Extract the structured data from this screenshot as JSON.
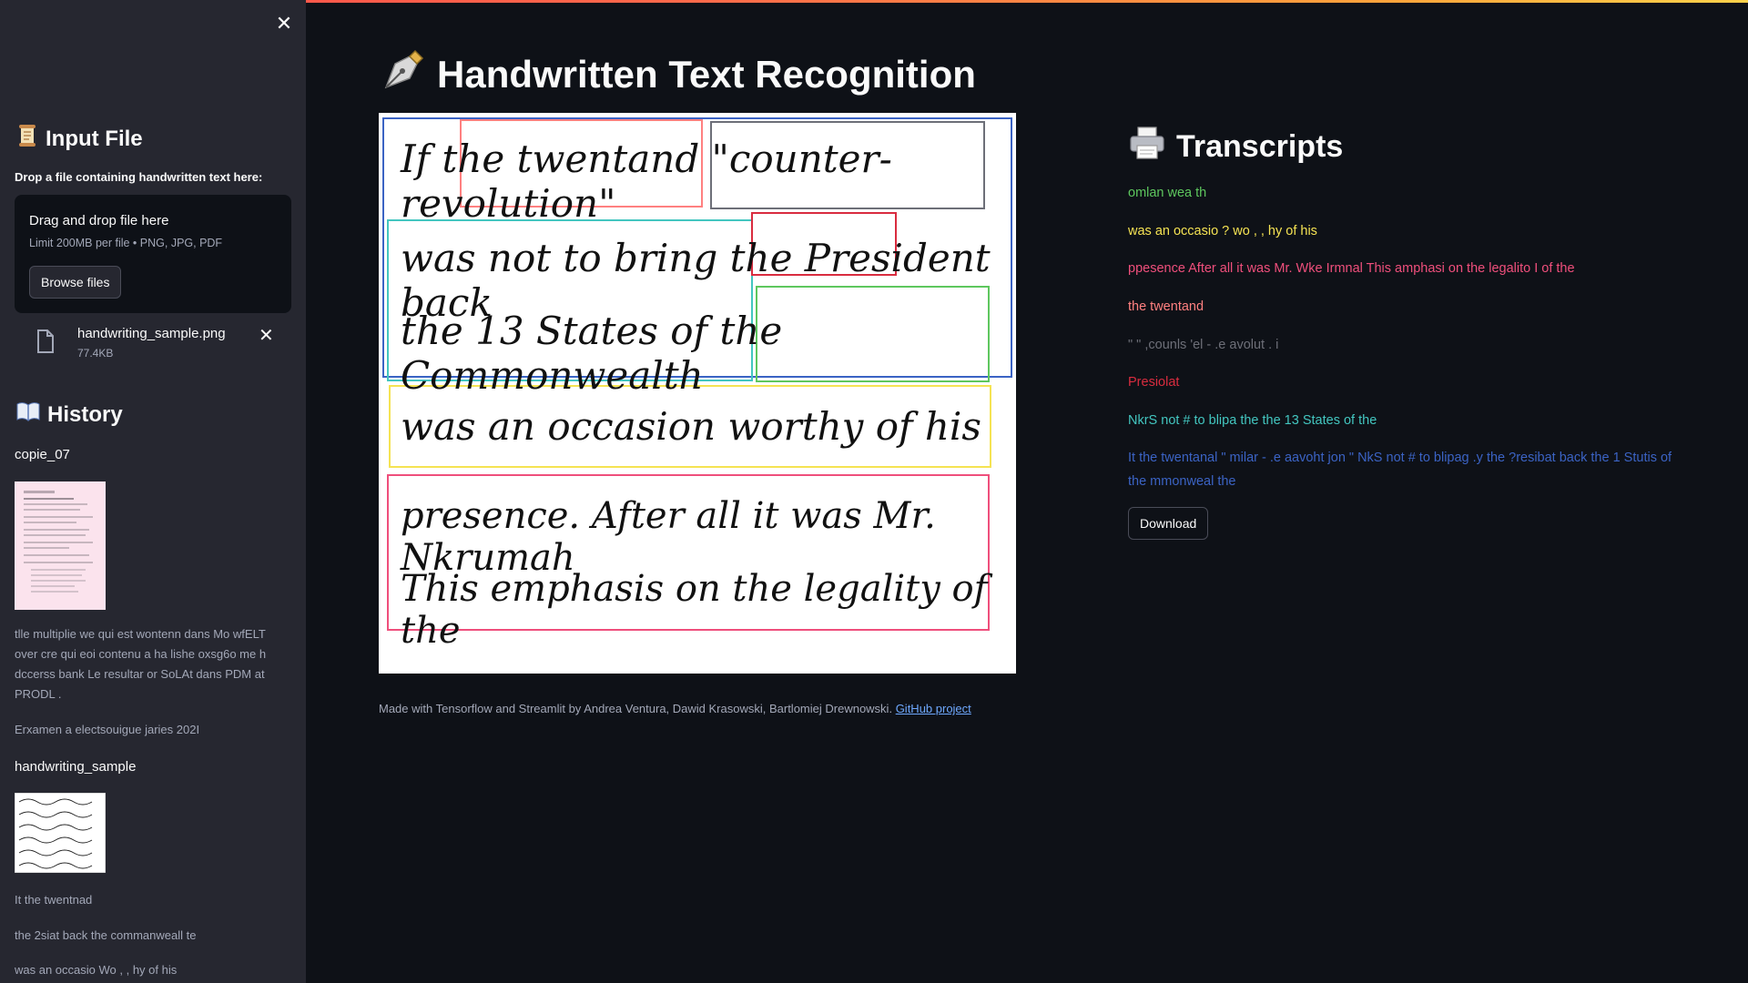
{
  "sidebar": {
    "close_label": "✕",
    "input_heading": "Input File",
    "drop_label": "Drop a file containing handwritten text here:",
    "dropzone": {
      "title": "Drag and drop file here",
      "limits": "Limit 200MB per file • PNG, JPG, PDF",
      "browse_label": "Browse files"
    },
    "uploaded_file": {
      "name": "handwriting_sample.png",
      "size": "77.4KB"
    },
    "history_heading": "History",
    "history": [
      {
        "name": "copie_07",
        "lines": [
          "tlle multiplie we qui est wontenn dans Mo wfELT over cre qui eoi contenu a ha lishe oxsg6o me h dccerss bank Le resultar or SoLAt dans PDM at PRODL .",
          "Erxamen a electsouigue jaries 202I"
        ]
      },
      {
        "name": "handwriting_sample",
        "lines": [
          "It the twentnad",
          "the 2siat back the commanweall te",
          "was an occasio Wo , , hy of his"
        ]
      }
    ]
  },
  "main": {
    "title": "Handwritten Text Recognition",
    "image": {
      "rows": [
        "If the twentand \"counter-revolution\"",
        "was not to bring the President back",
        "the 13 States of the Commonwealth",
        "was an occasion worthy of his",
        "presence. After all it was Mr. Nkrumah",
        "This emphasis on the legality of the"
      ]
    },
    "caption": "Made with Tensorflow and Streamlit by Andrea Ventura, Dawid Krasowski, Bartlomiej Drewnowski.",
    "caption_link": "GitHub project"
  },
  "transcripts": {
    "title": "Transcripts",
    "lines": [
      {
        "text": "omlan wea th",
        "color": "#5ec75e"
      },
      {
        "text": "was an occasio ? wo , , hy of his",
        "color": "#f5e353"
      },
      {
        "text": "ppesence After all it was Mr. Wke Irmnal This amphasi on the legalito I of the",
        "color": "#ef4f7c"
      },
      {
        "text": "the twentand",
        "color": "#ff8080"
      },
      {
        "text": "\" \" ,counls 'el - .e avolut . i",
        "color": "#6d6f78"
      },
      {
        "text": "Presiolat",
        "color": "#d92c3f"
      },
      {
        "text": "NkrS not # to blipa the the 13 States of the",
        "color": "#43c6c0"
      },
      {
        "text": "It the twentanal \" milar - .e aavoht jon \" NkS not # to blipag .y the ?resibat back the 1 Stutis of the mmonweal the",
        "color": "#3b63c4"
      }
    ],
    "download_label": "Download"
  },
  "icons": {
    "close": "close-icon",
    "scroll": "scroll-icon",
    "book": "open-book-icon",
    "pen": "fountain-pen-icon",
    "printer": "printer-icon",
    "file": "file-icon"
  },
  "colors": {
    "background": "#0e1117",
    "sidebar": "#262730",
    "link": "#6ea8fe"
  }
}
